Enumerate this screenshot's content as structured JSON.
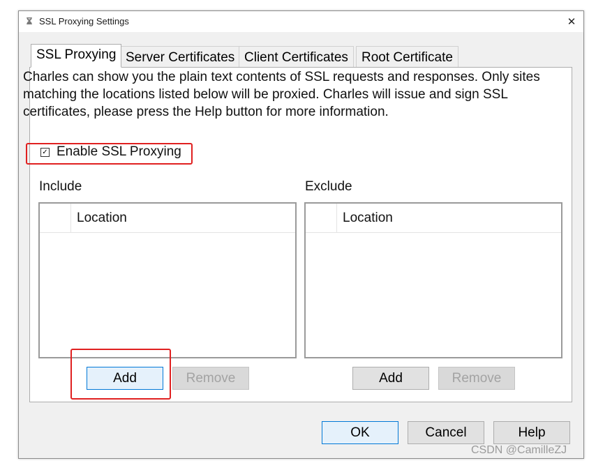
{
  "window": {
    "title": "SSL Proxying Settings",
    "close_glyph": "✕"
  },
  "tabs": [
    {
      "label": "SSL Proxying",
      "active": true
    },
    {
      "label": "Server Certificates",
      "active": false
    },
    {
      "label": "Client Certificates",
      "active": false
    },
    {
      "label": "Root Certificate",
      "active": false
    }
  ],
  "ssl_proxying": {
    "description": "Charles can show you the plain text contents of SSL requests and responses. Only sites matching the locations listed below will be proxied. Charles will issue and sign SSL certificates, please press the Help button for more information.",
    "enable_checkbox": {
      "label": "Enable SSL Proxying",
      "checked": true,
      "glyph": "✓"
    },
    "include": {
      "label": "Include",
      "column": "Location",
      "rows": [],
      "add_label": "Add",
      "remove_label": "Remove"
    },
    "exclude": {
      "label": "Exclude",
      "column": "Location",
      "rows": [],
      "add_label": "Add",
      "remove_label": "Remove"
    }
  },
  "footer": {
    "ok_label": "OK",
    "cancel_label": "Cancel",
    "help_label": "Help"
  },
  "annotation_color": "#e02020",
  "watermark": "CSDN @CamilleZJ"
}
